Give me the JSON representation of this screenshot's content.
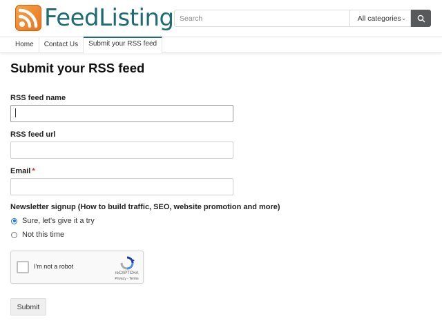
{
  "site": {
    "name": "FeedListing",
    "brand_color": "#1d6b73",
    "logo_icon": "rss-icon"
  },
  "search": {
    "placeholder": "Search",
    "category_selected": "All categories",
    "button_icon": "search-icon"
  },
  "nav": {
    "items": [
      "Home",
      "Contact Us",
      "Submit your RSS feed"
    ],
    "active_index": 2
  },
  "page": {
    "title": "Submit your RSS feed"
  },
  "form": {
    "feed_name_label": "RSS feed name",
    "feed_name_value": "",
    "feed_url_label": "RSS feed url",
    "feed_url_value": "",
    "email_label": "Email",
    "email_required_marker": "*",
    "email_value": "",
    "newsletter_label": "Newsletter signup (How to build traffic, SEO, website promotion and more)",
    "newsletter_options": [
      "Sure, let's give it a try",
      "Not this time"
    ],
    "newsletter_selected": 0,
    "submit_label": "Submit"
  },
  "recaptcha": {
    "label": "I'm not a robot",
    "brand": "reCAPTCHA",
    "terms": "Privacy - Terms"
  }
}
